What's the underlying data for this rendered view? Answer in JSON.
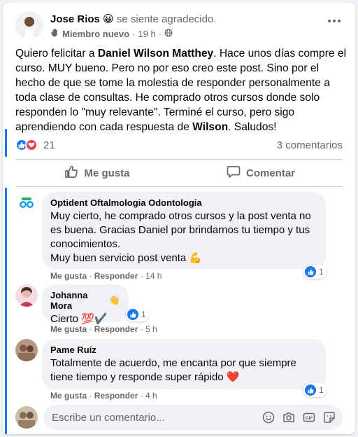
{
  "post": {
    "author": "Jose Rios",
    "feeling_emoji": "😀",
    "feeling_text": "se siente agradecido.",
    "badge": "Miembro nuevo",
    "time": "19 h",
    "body_parts": [
      {
        "text": "Quiero felicitar a ",
        "bold": false
      },
      {
        "text": "Daniel Wilson Matthey",
        "bold": true
      },
      {
        "text": ".  Hace unos días compre el curso. MUY bueno. Pero no por eso creo este post. Sino por el hecho de que se tome la molestia de responder personalmente a toda clase de consultas. He comprado otros cursos donde solo responden lo \"muy relevante\". Terminé el curso, pero sigo aprendiendo con cada respuesta de ",
        "bold": false
      },
      {
        "text": "Wilson",
        "bold": true
      },
      {
        "text": ". Saludos!",
        "bold": false
      }
    ],
    "reaction_count": "21",
    "comments_count": "3 comentarios"
  },
  "actions": {
    "like_label": "Me gusta",
    "comment_label": "Comentar"
  },
  "comments": [
    {
      "name": "Optident Oftalmologia Odontologia",
      "lines": [
        "Muy cierto, he comprado otros cursos y la post venta no",
        "es buena. Gracias Daniel por brindarnos tu tiempo y tus",
        "conocimientos.",
        "Muy buen servicio post venta 💪"
      ],
      "like": "Me gusta",
      "reply": "Responder",
      "time": "14 h",
      "reactions": "1"
    },
    {
      "name": "Johanna Mora",
      "name_icon": "👋",
      "lines": [
        "Cierto 💯✔️"
      ],
      "like": "Me gusta",
      "reply": "Responder",
      "time": "5 h",
      "reactions": "1"
    },
    {
      "name": "Pame Ruíz",
      "lines": [
        "Totalmente de acuerdo, me encanta por que siempre",
        "tiene tiempo y responde super rápido ❤️"
      ],
      "like": "Me gusta",
      "reply": "Responder",
      "time": "4 h",
      "reactions": "1"
    }
  ],
  "composer": {
    "placeholder": "Escribe un comentario..."
  },
  "icons": {
    "header_more": "more-horizontal-icon",
    "wave": "wave-icon",
    "globe": "globe-icon",
    "like": "thumbs-up-icon",
    "love": "heart-icon",
    "comment": "speech-bubble-icon",
    "emoji": "smiley-icon",
    "camera": "camera-icon",
    "gif": "gif-icon",
    "sticker": "sticker-icon"
  },
  "colors": {
    "accent": "#1877f2",
    "love": "#f33e58",
    "muted": "#65676b"
  }
}
